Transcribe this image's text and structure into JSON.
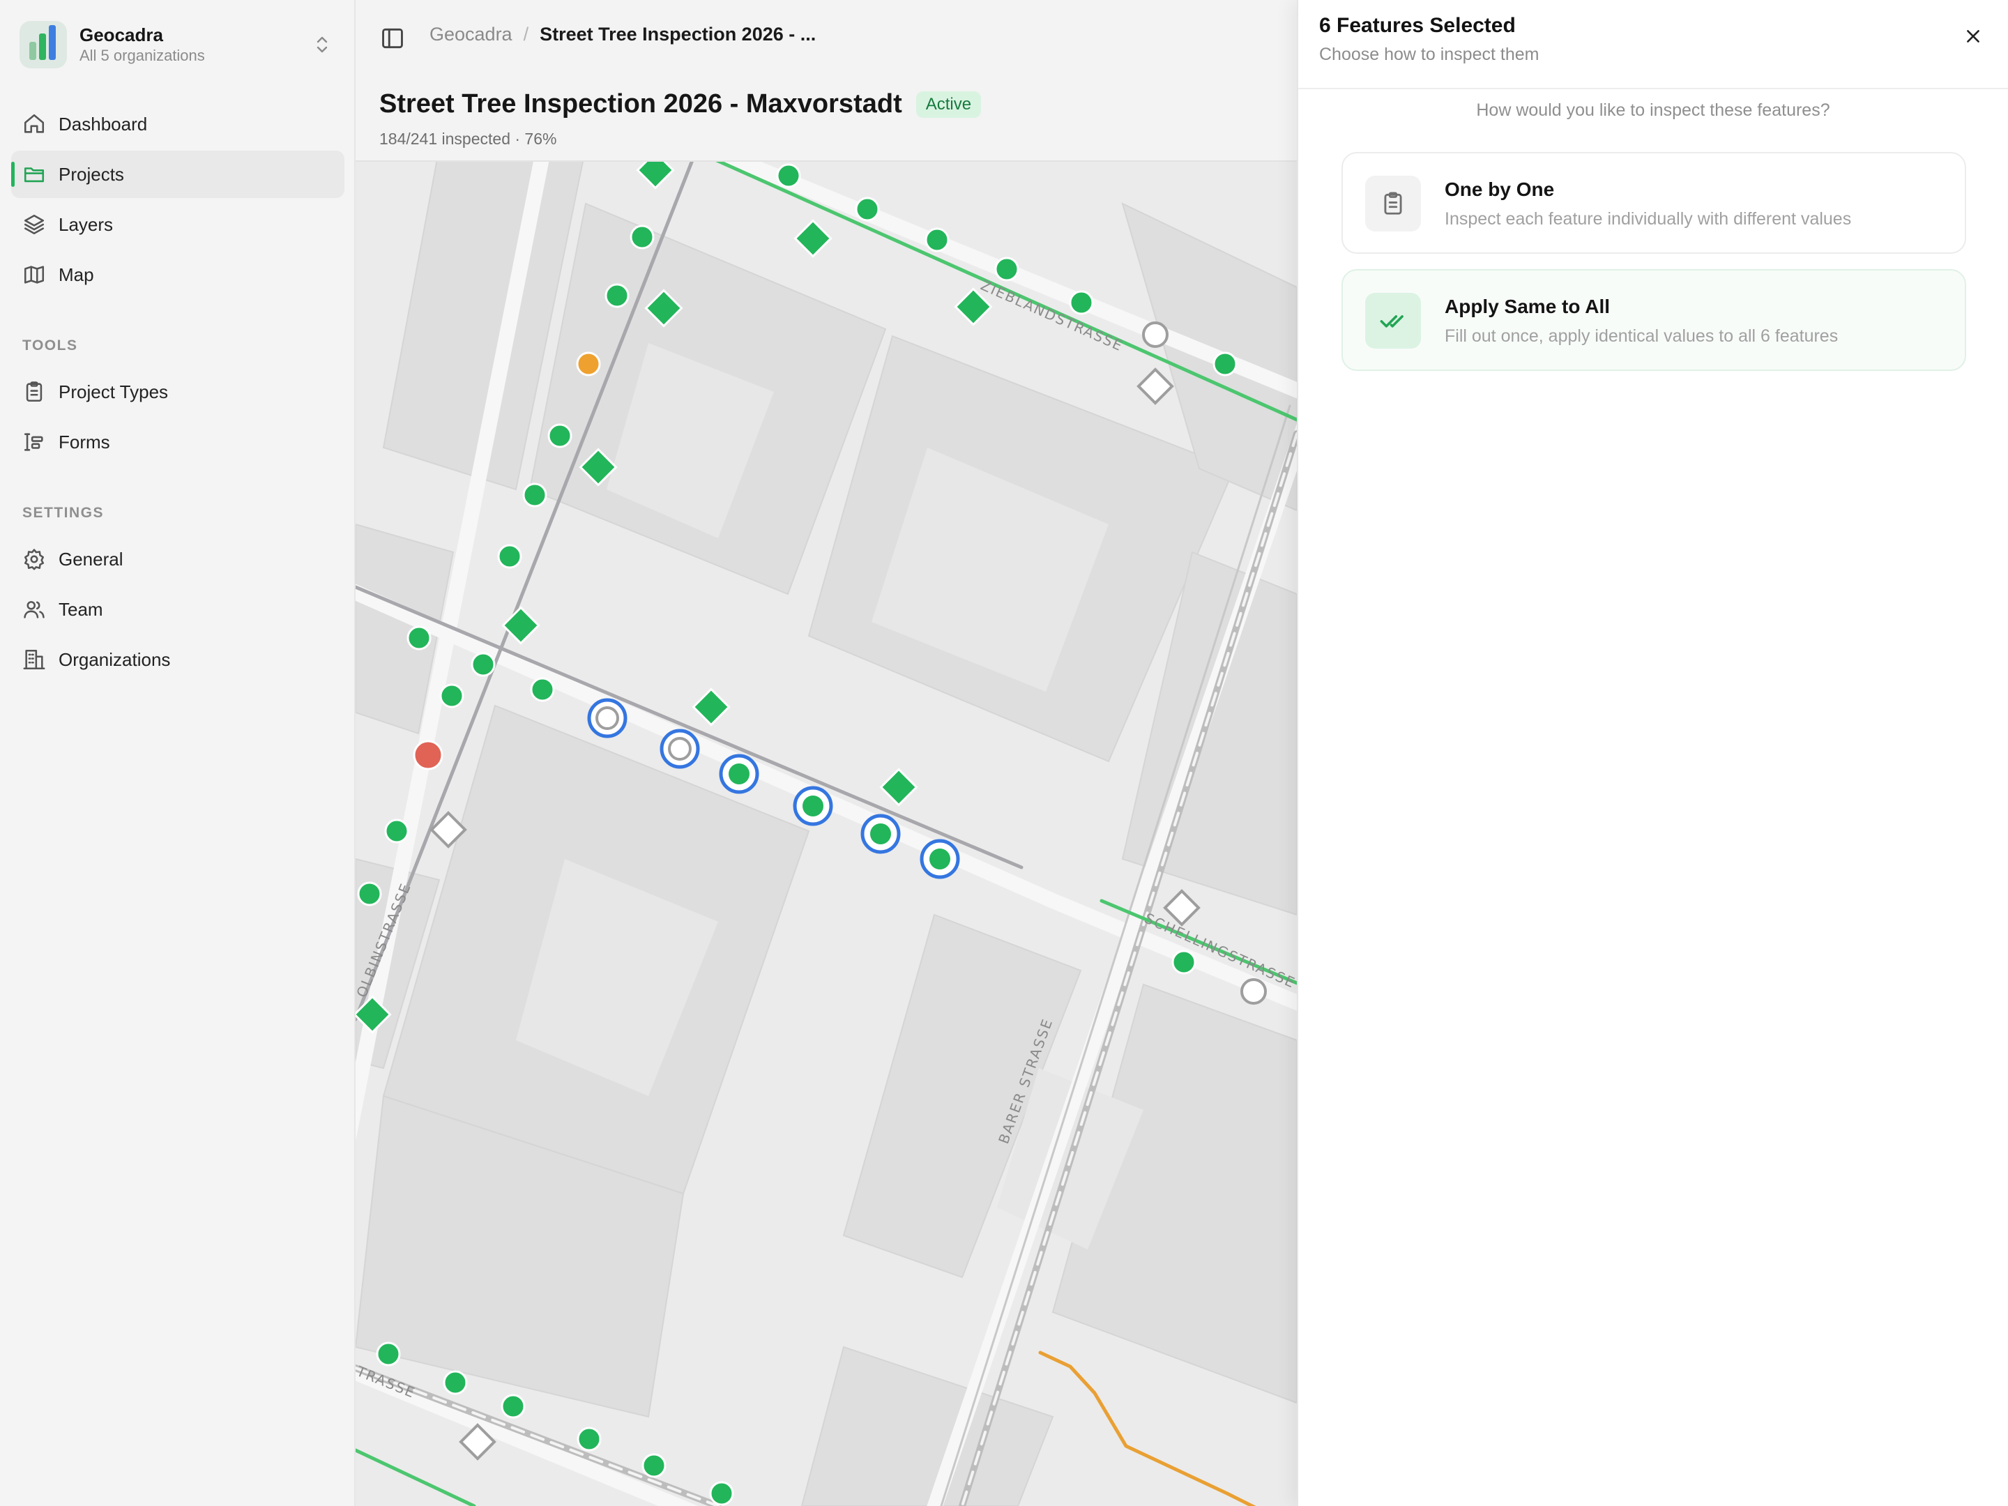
{
  "org": {
    "name": "Geocadra",
    "subtitle": "All 5 organizations"
  },
  "nav": {
    "main": [
      {
        "label": "Dashboard",
        "icon": "home-icon"
      },
      {
        "label": "Projects",
        "icon": "folder-icon",
        "active": true
      },
      {
        "label": "Layers",
        "icon": "layers-icon"
      },
      {
        "label": "Map",
        "icon": "map-icon"
      }
    ],
    "tools_label": "TOOLS",
    "tools": [
      {
        "label": "Project Types",
        "icon": "clipboard-icon"
      },
      {
        "label": "Forms",
        "icon": "form-icon"
      }
    ],
    "settings_label": "SETTINGS",
    "settings": [
      {
        "label": "General",
        "icon": "gear-icon"
      },
      {
        "label": "Team",
        "icon": "users-icon"
      },
      {
        "label": "Organizations",
        "icon": "building-icon"
      }
    ]
  },
  "header": {
    "breadcrumb_root": "Geocadra",
    "breadcrumb_sep": "/",
    "breadcrumb_current": "Street Tree Inspection 2026 - ...",
    "title": "Street Tree Inspection 2026 - Maxvorstadt",
    "status": "Active",
    "progress": "184/241 inspected · 76%"
  },
  "map": {
    "street_labels": [
      "ZIEBLANDSTRASSE",
      "SCHELLINGSTRASSE",
      "BARER STRASSE",
      "OLBINSTRASSE",
      "TRASSE"
    ],
    "colors": {
      "inspected": "#22b55a",
      "pending": "#b0b0b0",
      "issue": "#e06355",
      "warning": "#eea12e",
      "selection": "#3576e0",
      "route_green": "#4cc66f",
      "route_orange": "#e9a033"
    }
  },
  "panel": {
    "title": "6 Features Selected",
    "subtitle": "Choose how to inspect them",
    "question": "How would you like to inspect these features?",
    "options": [
      {
        "title": "One by One",
        "description": "Inspect each feature individually with different values",
        "icon": "clipboard-icon"
      },
      {
        "title": "Apply Same to All",
        "description": "Fill out once, apply identical values to all 6 features",
        "icon": "double-check-icon"
      }
    ]
  }
}
